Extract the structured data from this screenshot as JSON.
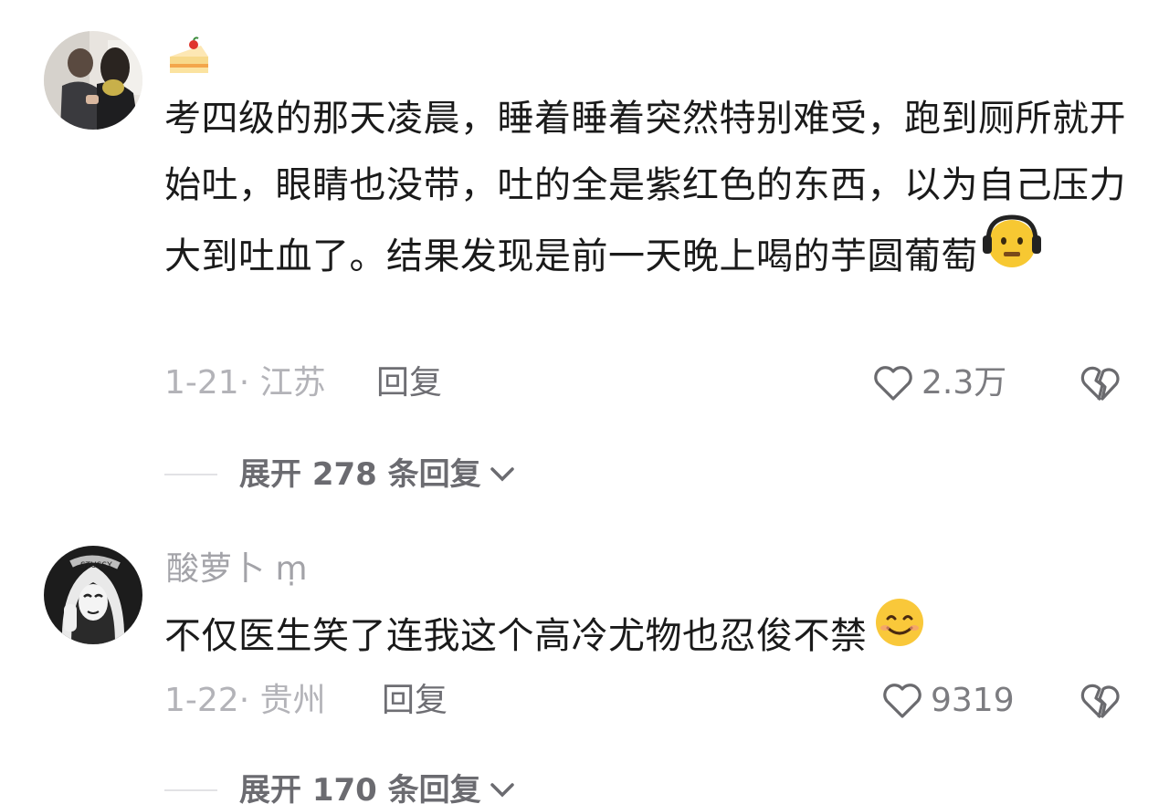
{
  "comments": [
    {
      "username": "",
      "username_icon": "cake-icon",
      "text": "考四级的那天凌晨，睡着睡着突然特别难受，跑到厕所就开始吐，眼睛也没带，吐的全是紫红色的东西，以为自己压力大到吐血了。结果发现是前一天晚上喝的芋圆葡萄",
      "trailing_emoji": "headphones-frown-emoji",
      "date_location": "1-21· 江苏",
      "reply_label": "回复",
      "likes": "2.3万",
      "expand_label": "展开 278 条回复"
    },
    {
      "username": "酸萝卜",
      "username_suffix": "ṃ",
      "text": "不仅医生笑了连我这个高冷尤物也忍俊不禁",
      "trailing_emoji": "smiling-emoji",
      "date_location": "1-22· 贵州",
      "reply_label": "回复",
      "likes": "9319",
      "expand_label": "展开 170 条回复"
    }
  ],
  "colors": {
    "text_primary": "#1a1a1a",
    "text_secondary": "#a3a3a8",
    "reply_text": "#6e6e73",
    "expand_text": "#6b6b70",
    "divider": "#e2e2e5"
  }
}
